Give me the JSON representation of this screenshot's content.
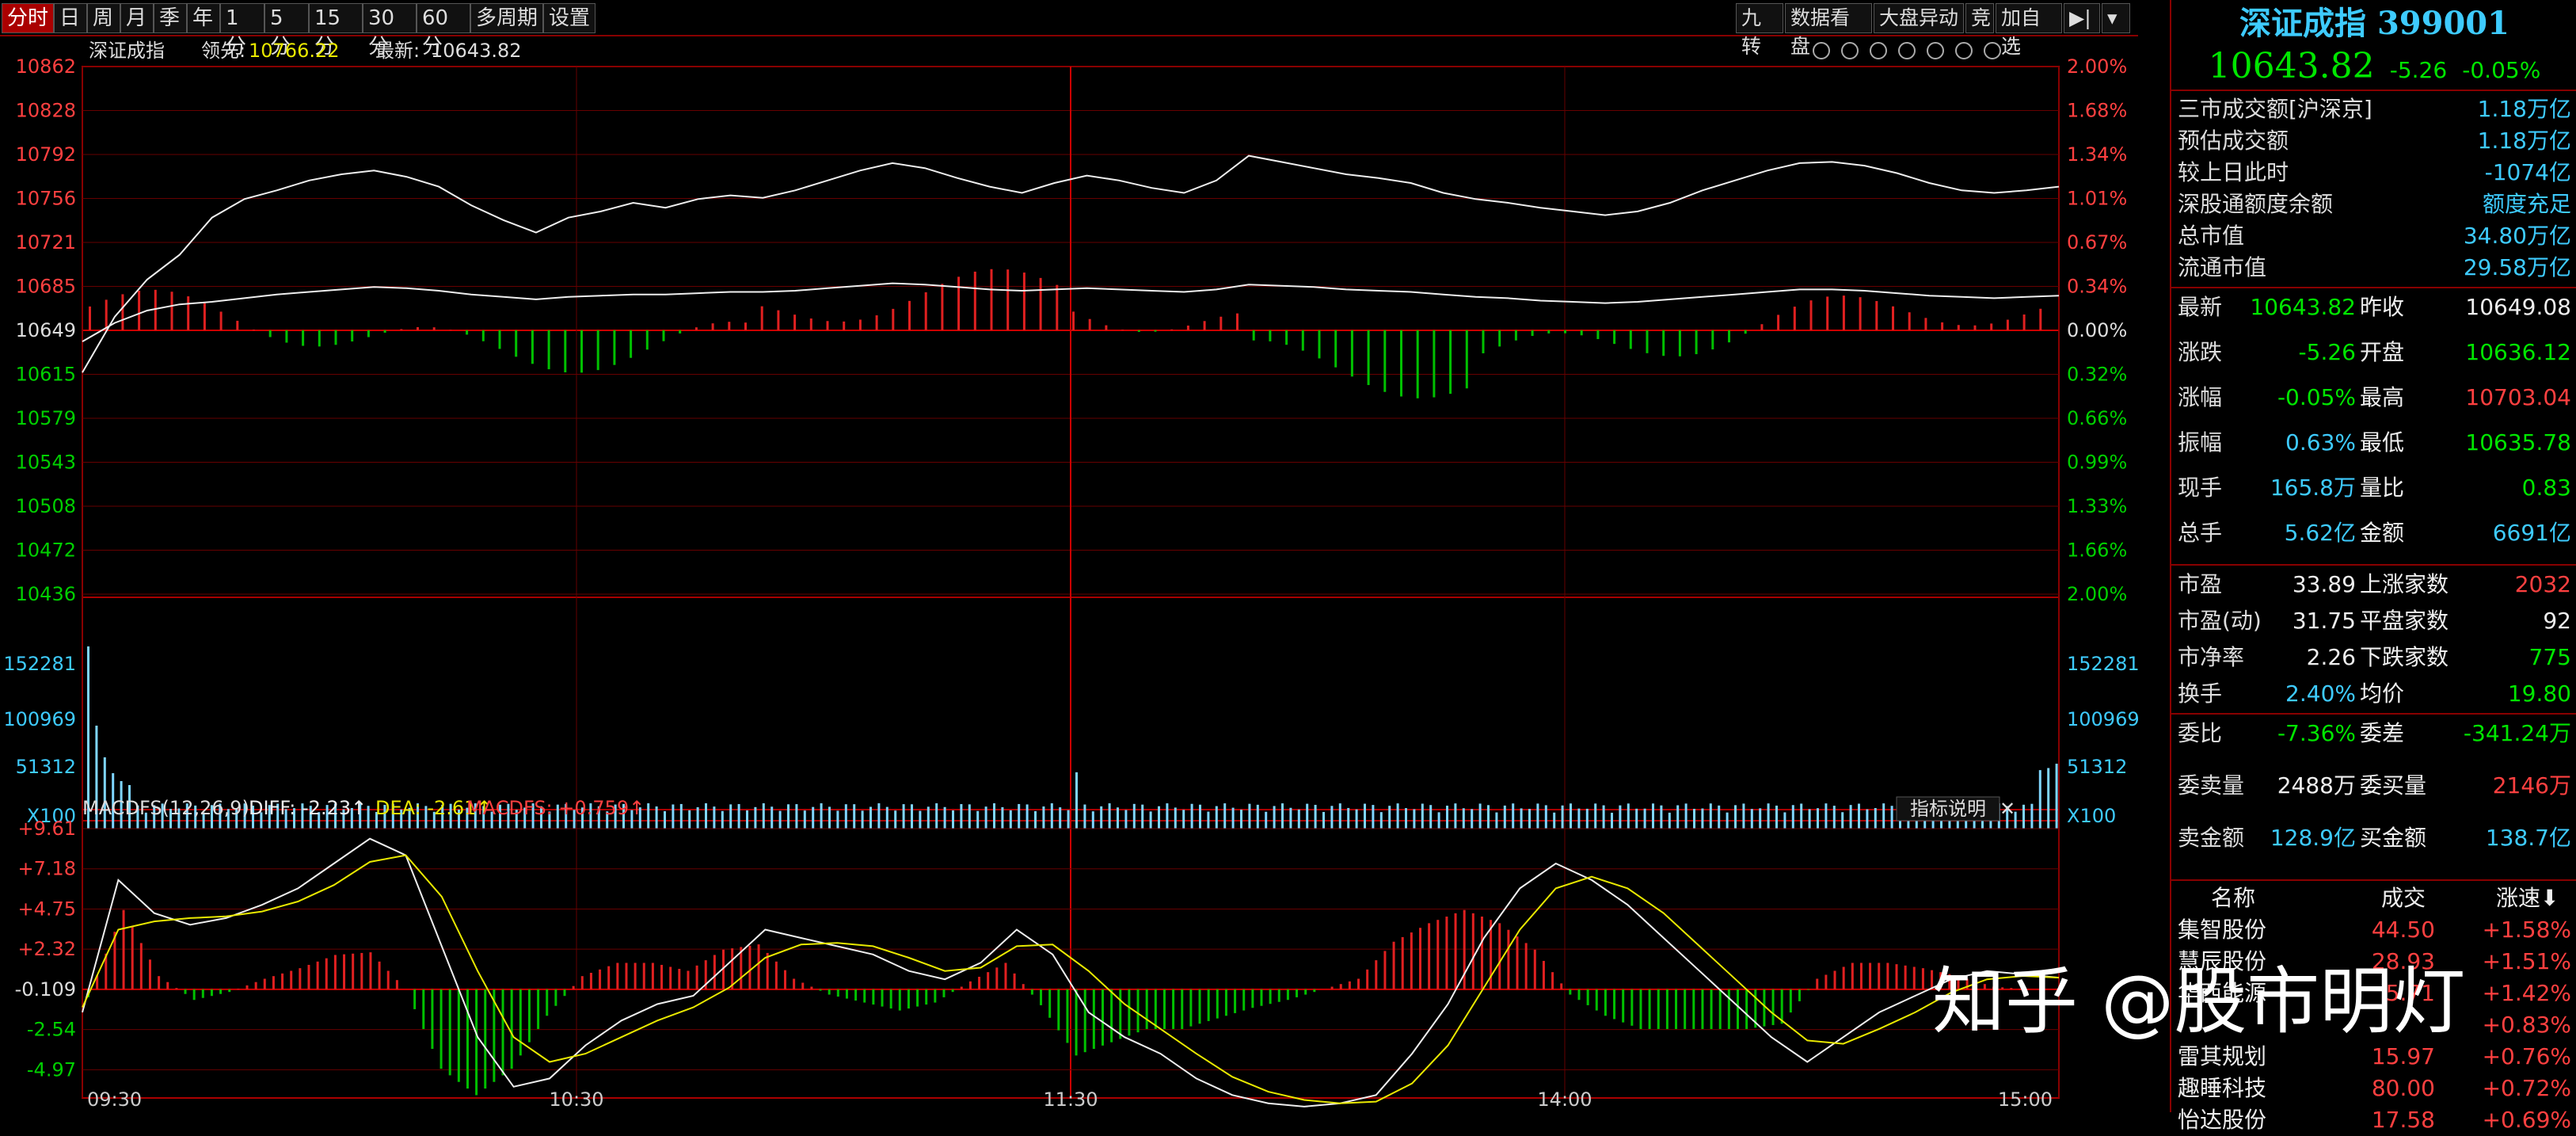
{
  "tabs": [
    "分时",
    "日",
    "周",
    "月",
    "季",
    "年",
    "1分",
    "5分",
    "15分",
    "30分",
    "60分",
    "多周期",
    "设置"
  ],
  "right_tools": [
    "九转",
    "数据看盘",
    "大盘异动",
    "竞",
    "加自选",
    "▶|",
    "▾"
  ],
  "chart_header": {
    "name": "深证成指",
    "lead_label": "领先:",
    "lead_value": "10766.22",
    "latest_label": "最新:",
    "latest_value": "10643.82"
  },
  "price_axis_left": [
    "10862",
    "10828",
    "10792",
    "10756",
    "10721",
    "10685",
    "10649",
    "10615",
    "10579",
    "10543",
    "10508",
    "10472",
    "10436"
  ],
  "pct_axis_right": [
    "2.00%",
    "1.68%",
    "1.34%",
    "1.01%",
    "0.67%",
    "0.34%",
    "0.00%",
    "0.32%",
    "0.66%",
    "0.99%",
    "1.33%",
    "1.66%",
    "2.00%"
  ],
  "volume_axis": [
    "152281",
    "100969",
    "51312",
    "X100"
  ],
  "macd_header": {
    "name": "MACDFS(12,26,9)",
    "diff": "DIFF: -2.23↑",
    "dea": "DEA: -2.61↑",
    "macdfs": "MACDFS: +0.759↑",
    "help": "指标说明",
    "close": "✕"
  },
  "macd_axis": [
    "+9.61",
    "+7.18",
    "+4.75",
    "+2.32",
    "-0.109",
    "-2.54",
    "-4.97"
  ],
  "time_axis": [
    "09:30",
    "10:30",
    "11:30",
    "14:00",
    "15:00"
  ],
  "chart_data": {
    "type": "line",
    "title": "深证成指",
    "prev_close": 10649.08,
    "ylim": [
      10436,
      10862
    ],
    "price": [
      10615,
      10660,
      10690,
      10710,
      10740,
      10755,
      10762,
      10770,
      10775,
      10778,
      10773,
      10765,
      10750,
      10738,
      10728,
      10740,
      10745,
      10752,
      10748,
      10755,
      10758,
      10756,
      10762,
      10770,
      10778,
      10784,
      10780,
      10772,
      10765,
      10760,
      10768,
      10774,
      10770,
      10764,
      10760,
      10770,
      10790,
      10785,
      10780,
      10775,
      10772,
      10768,
      10760,
      10755,
      10752,
      10748,
      10745,
      10742,
      10745,
      10752,
      10762,
      10770,
      10778,
      10784,
      10785,
      10782,
      10776,
      10768,
      10762,
      10760,
      10762,
      10765
    ],
    "avg": [
      10640,
      10655,
      10665,
      10670,
      10672,
      10675,
      10678,
      10680,
      10682,
      10684,
      10683,
      10681,
      10678,
      10676,
      10674,
      10676,
      10677,
      10678,
      10678,
      10679,
      10680,
      10680,
      10681,
      10683,
      10685,
      10687,
      10686,
      10684,
      10682,
      10681,
      10682,
      10683,
      10682,
      10681,
      10680,
      10682,
      10686,
      10685,
      10684,
      10682,
      10681,
      10680,
      10678,
      10676,
      10675,
      10673,
      10672,
      10671,
      10672,
      10674,
      10676,
      10678,
      10680,
      10682,
      10682,
      10681,
      10679,
      10677,
      10676,
      10675,
      10676,
      10677
    ],
    "volume_note": "X100",
    "macd_diff": [
      -1.5,
      6.5,
      4.5,
      3.8,
      4.2,
      5.0,
      6.0,
      7.5,
      9.0,
      8.0,
      2.5,
      -3.0,
      -6.0,
      -5.5,
      -3.5,
      -2.0,
      -1.0,
      -0.5,
      1.5,
      3.5,
      3.0,
      2.5,
      2.0,
      1.0,
      0.5,
      1.5,
      3.5,
      2.0,
      -1.5,
      -3.0,
      -4.0,
      -5.5,
      -6.5,
      -7.0,
      -7.2,
      -7.0,
      -6.5,
      -4.0,
      -1.0,
      3.0,
      6.0,
      7.5,
      6.5,
      5.0,
      3.0,
      1.0,
      -1.0,
      -3.0,
      -4.5,
      -3.0,
      -1.5,
      -0.5,
      0.5,
      1.0,
      0.8,
      0.6
    ],
    "macd_dea": [
      -1.2,
      3.5,
      4.0,
      4.2,
      4.3,
      4.6,
      5.2,
      6.2,
      7.6,
      8.0,
      5.5,
      1.0,
      -3.0,
      -4.5,
      -4.0,
      -3.0,
      -2.0,
      -1.2,
      0.0,
      1.8,
      2.6,
      2.7,
      2.5,
      1.8,
      1.0,
      1.2,
      2.5,
      2.6,
      1.0,
      -1.0,
      -2.5,
      -4.0,
      -5.4,
      -6.3,
      -6.8,
      -7.0,
      -6.9,
      -5.8,
      -3.5,
      0.0,
      3.5,
      6.0,
      6.7,
      6.0,
      4.5,
      2.5,
      0.5,
      -1.5,
      -3.2,
      -3.4,
      -2.5,
      -1.5,
      -0.3,
      0.5,
      0.7,
      0.6
    ]
  },
  "panel": {
    "title": "深证成指",
    "code": "399001",
    "price": "10643.82",
    "change": "-5.26",
    "change_pct": "-0.05%",
    "block1": [
      {
        "k": "三市成交额[沪深京]",
        "v": "1.18万亿",
        "vc": "c"
      },
      {
        "k": "预估成交额",
        "v": "1.18万亿",
        "vc": "c"
      },
      {
        "k": "较上日此时",
        "v": "-1074亿",
        "vc": "c"
      },
      {
        "k": "深股通额度余额",
        "v": "额度充足",
        "vc": "c"
      },
      {
        "k": "总市值",
        "v": "34.80万亿",
        "vc": "c"
      },
      {
        "k": "流通市值",
        "v": "29.58万亿",
        "vc": "c"
      }
    ],
    "block2": [
      {
        "k1": "最新",
        "v1": "10643.82",
        "c1": "g",
        "k2": "昨收",
        "v2": "10649.08",
        "c2": "w"
      },
      {
        "k1": "涨跌",
        "v1": "-5.26",
        "c1": "g",
        "k2": "开盘",
        "v2": "10636.12",
        "c2": "g"
      },
      {
        "k1": "涨幅",
        "v1": "-0.05%",
        "c1": "g",
        "k2": "最高",
        "v2": "10703.04",
        "c2": "r"
      },
      {
        "k1": "振幅",
        "v1": "0.63%",
        "c1": "c",
        "k2": "最低",
        "v2": "10635.78",
        "c2": "g"
      },
      {
        "k1": "现手",
        "v1": "165.8万",
        "c1": "c",
        "k2": "量比",
        "v2": "0.83",
        "c2": "g"
      },
      {
        "k1": "总手",
        "v1": "5.62亿",
        "c1": "c",
        "k2": "金额",
        "v2": "6691亿",
        "c2": "c"
      }
    ],
    "block3": [
      {
        "k1": "市盈",
        "v1": "33.89",
        "c1": "w",
        "k2": "上涨家数",
        "v2": "2032",
        "c2": "r"
      },
      {
        "k1": "市盈(动)",
        "v1": "31.75",
        "c1": "w",
        "k2": "平盘家数",
        "v2": "92",
        "c2": "w"
      },
      {
        "k1": "市净率",
        "v1": "2.26",
        "c1": "w",
        "k2": "下跌家数",
        "v2": "775",
        "c2": "g"
      },
      {
        "k1": "换手",
        "v1": "2.40%",
        "c1": "c",
        "k2": "均价",
        "v2": "19.80",
        "c2": "g"
      }
    ],
    "block4": [
      {
        "k1": "委比",
        "v1": "-7.36%",
        "c1": "g",
        "k2": "委差",
        "v2": "-341.24万",
        "c2": "g"
      },
      {
        "k1": "委卖量",
        "v1": "2488万",
        "c1": "w",
        "k2": "委买量",
        "v2": "2146万",
        "c2": "r"
      },
      {
        "k1": "卖金额",
        "v1": "128.9亿",
        "c1": "c",
        "k2": "买金额",
        "v2": "138.7亿",
        "c2": "c"
      }
    ],
    "list_headers": [
      "名称",
      "成交",
      "涨速⬇"
    ],
    "list": [
      {
        "name": "集智股份",
        "price": "44.50",
        "speed": "+1.58%"
      },
      {
        "name": "慧辰股份",
        "price": "28.93",
        "speed": "+1.51%"
      },
      {
        "name": "华西能源",
        "price": "5.71",
        "speed": "+1.42%"
      },
      {
        "name": "",
        "price": "",
        "speed": "+0.83%"
      },
      {
        "name": "雷其规划",
        "price": "15.97",
        "speed": "+0.76%"
      },
      {
        "name": "趣睡科技",
        "price": "80.00",
        "speed": "+0.72%"
      },
      {
        "name": "怡达股份",
        "price": "17.58",
        "speed": "+0.69%"
      }
    ]
  },
  "watermark": "知乎 @股市明灯"
}
